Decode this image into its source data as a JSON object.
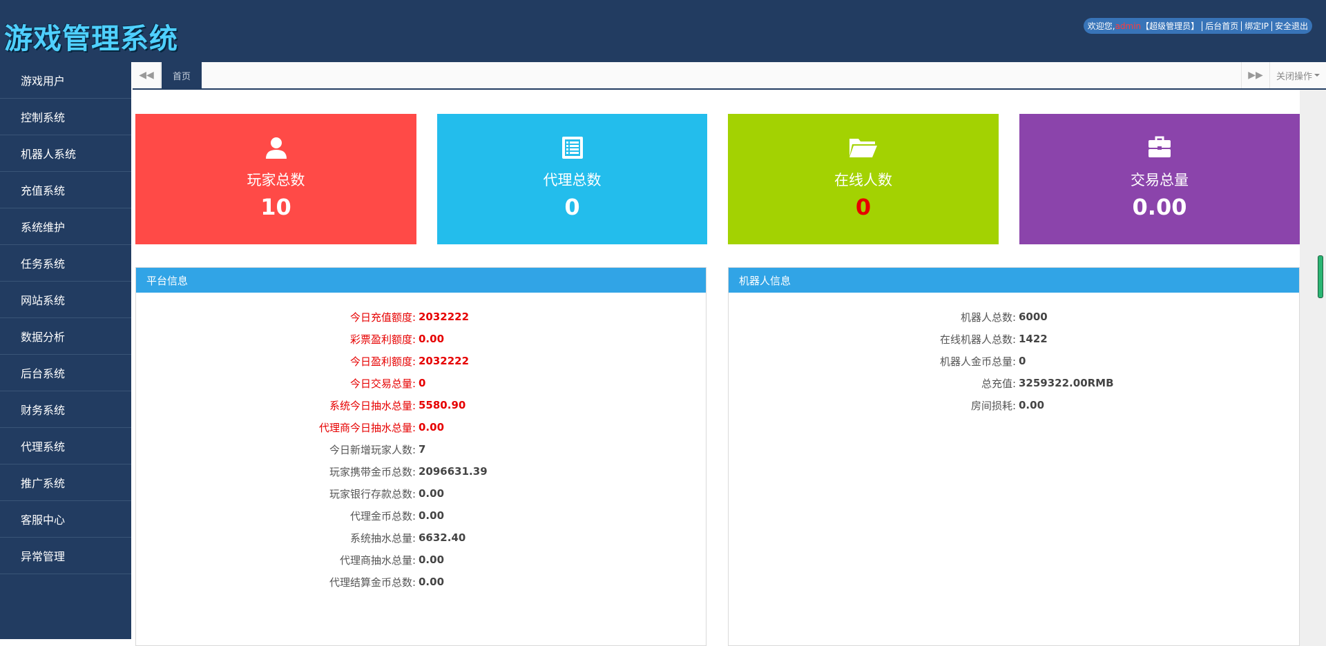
{
  "header": {
    "logo_text": "游戏管理系统",
    "welcome": "欢迎您,",
    "username": "admin",
    "role": "【超级管理员】",
    "links": [
      "后台首页",
      "绑定IP",
      "安全退出"
    ]
  },
  "sidebar": {
    "items": [
      {
        "label": "游戏用户"
      },
      {
        "label": "控制系统"
      },
      {
        "label": "机器人系统"
      },
      {
        "label": "充值系统"
      },
      {
        "label": "系统维护"
      },
      {
        "label": "任务系统"
      },
      {
        "label": "网站系统"
      },
      {
        "label": "数据分析"
      },
      {
        "label": "后台系统"
      },
      {
        "label": "财务系统"
      },
      {
        "label": "代理系统"
      },
      {
        "label": "推广系统"
      },
      {
        "label": "客服中心"
      },
      {
        "label": "异常管理"
      }
    ]
  },
  "tabs": {
    "home_label": "首页",
    "close_label": "关闭操作"
  },
  "stats": [
    {
      "label": "玩家总数",
      "value": "10",
      "icon": "user-icon",
      "color": "#ff4a47"
    },
    {
      "label": "代理总数",
      "value": "0",
      "icon": "list-icon",
      "color": "#23bdec"
    },
    {
      "label": "在线人数",
      "value": "0",
      "icon": "folder-open-icon",
      "color": "#a3d202",
      "value_color": "#e60000"
    },
    {
      "label": "交易总量",
      "value": "0.00",
      "icon": "briefcase-icon",
      "color": "#8b44ab"
    }
  ],
  "platform": {
    "title": "平台信息",
    "rows": [
      {
        "k": "今日充值额度:",
        "v": "2032222",
        "red": true
      },
      {
        "k": "彩票盈利额度:",
        "v": "0.00",
        "red": true
      },
      {
        "k": "今日盈利额度:",
        "v": "2032222",
        "red": true
      },
      {
        "k": "今日交易总量:",
        "v": "0",
        "red": true
      },
      {
        "k": "系统今日抽水总量:",
        "v": "5580.90",
        "red": true
      },
      {
        "k": "代理商今日抽水总量:",
        "v": "0.00",
        "red": true
      },
      {
        "k": "今日新增玩家人数:",
        "v": "7",
        "red": false
      },
      {
        "k": "玩家携带金币总数:",
        "v": "2096631.39",
        "red": false
      },
      {
        "k": "玩家银行存款总数:",
        "v": "0.00",
        "red": false
      },
      {
        "k": "代理金币总数:",
        "v": "0.00",
        "red": false
      },
      {
        "k": "系统抽水总量:",
        "v": "6632.40",
        "red": false
      },
      {
        "k": "代理商抽水总量:",
        "v": "0.00",
        "red": false
      },
      {
        "k": "代理结算金币总数:",
        "v": "0.00",
        "red": false
      }
    ]
  },
  "robot": {
    "title": "机器人信息",
    "rows": [
      {
        "k": "机器人总数:",
        "v": "6000"
      },
      {
        "k": "在线机器人总数:",
        "v": "1422"
      },
      {
        "k": "机器人金币总量:",
        "v": "0"
      },
      {
        "k": "总充值:",
        "v": "3259322.00RMB"
      },
      {
        "k": "房间损耗:",
        "v": "0.00"
      }
    ]
  }
}
